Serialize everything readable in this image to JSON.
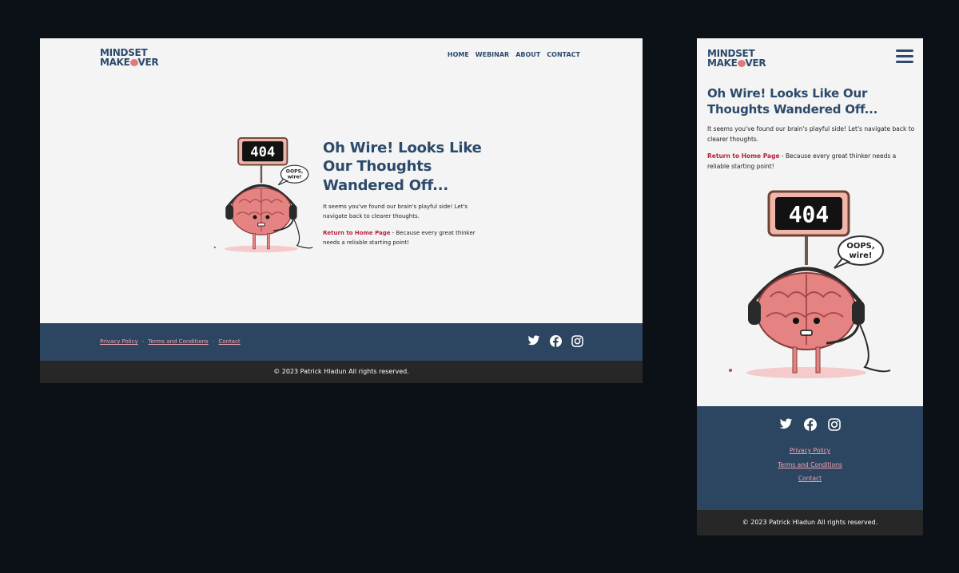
{
  "brand": {
    "line1": "MINDSET",
    "line2_a": "MAKE",
    "line2_b": "VER"
  },
  "nav": {
    "items": [
      "HOME",
      "WEBINAR",
      "ABOUT",
      "CONTACT"
    ]
  },
  "error": {
    "title": "Oh Wire! Looks Like Our Thoughts Wandered Off...",
    "message": "It seems you've found our brain's playful side! Let's navigate back to clearer thoughts.",
    "link_label": "Return to Home Page",
    "link_suffix": " - Because every great thinker needs a reliable starting point!",
    "sign_text": "404",
    "bubble_line1": "OOPS,",
    "bubble_line2": "wire!"
  },
  "footer": {
    "links": [
      "Privacy Policy",
      "Terms and Conditions",
      "Contact"
    ],
    "separator": "·",
    "social": [
      "twitter-icon",
      "facebook-icon",
      "instagram-icon"
    ],
    "copyright": "© 2023 Patrick Hladun All rights reserved."
  },
  "colors": {
    "page_bg": "#0c1017",
    "frame_bg": "#f4f4f4",
    "brand_blue": "#2c4a6b",
    "footer_bg": "#2c4560",
    "copyright_bg": "#272727",
    "link_pink": "#f2a4b0",
    "link_red": "#b8213a",
    "brain_pink": "#e07a7a"
  }
}
